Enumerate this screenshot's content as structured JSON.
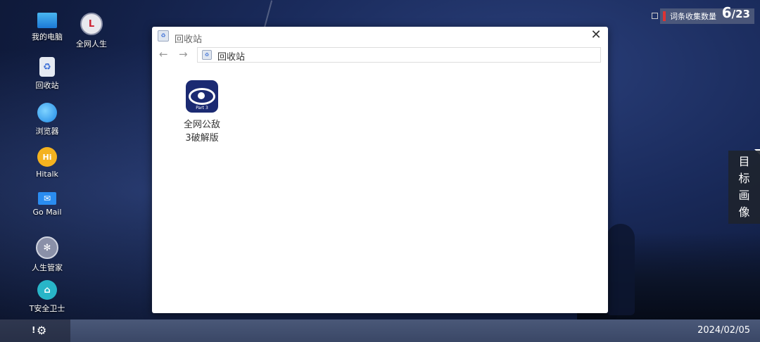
{
  "desktop": {
    "icons": [
      {
        "label": "我的电脑",
        "icon": "monitor-icon"
      },
      {
        "label": "全网人生",
        "icon": "app-logo-icon"
      },
      {
        "label": "回收站",
        "icon": "recycle-bin-icon"
      },
      {
        "label": "浏览器",
        "icon": "globe-icon"
      },
      {
        "label": "Hitalk",
        "icon": "hitalk-icon",
        "glyph": "Hi"
      },
      {
        "label": "Go Mail",
        "icon": "mail-icon"
      },
      {
        "label": "人生管家",
        "icon": "butler-icon"
      },
      {
        "label": "T安全卫士",
        "icon": "shield-icon"
      }
    ]
  },
  "counter": {
    "label": "词条收集数量",
    "current": "6",
    "total": "/23"
  },
  "side_panel": {
    "chars": [
      "目",
      "标",
      "画",
      "像"
    ]
  },
  "window": {
    "title": "回收站",
    "address": "回收站",
    "close_glyph": "✕",
    "back_glyph": "←",
    "forward_glyph": "→",
    "file": {
      "name_line1": "全网公敌",
      "name_line2": "3破解版",
      "badge": "Part 3"
    }
  },
  "taskbar": {
    "excl": "!",
    "gear_glyph": "⚙",
    "date": "2024/02/05"
  },
  "colors": {
    "accent": "#3b6fd6",
    "counter_bar": "#dd3333",
    "file_icon_bg": "#1b2a72"
  }
}
